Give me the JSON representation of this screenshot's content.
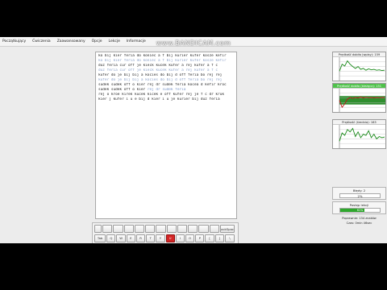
{
  "watermark": "www.BANDICAM.com",
  "menubar": [
    "Początkujący",
    "Ćwiczenia",
    "Zaawansowany",
    "Opcje",
    "Lekcje",
    "Informacje"
  ],
  "text_panel": {
    "lines": [
      {
        "type": "typed",
        "text": "ko bij kier feria do koniec a f bij kurier kufer kosze kefir"
      },
      {
        "type": "target",
        "text": "ko bij kier feria do koniec a f bij kurier kufer kosze kefir"
      },
      {
        "type": "typed",
        "text": "duz feria cur off je kieck kucek kufer a rej kufer a f c"
      },
      {
        "type": "target",
        "text": "duz feria cur off je kieck kucek kufer a rej kufer a f c"
      },
      {
        "type": "typed",
        "text": "kufer do je bij bij a kocies do bij d off feria bo rej rej"
      },
      {
        "type": "target",
        "text": "kufer do je bij bij a kocies do bij d off feria bo rej rej"
      },
      {
        "type": "typed",
        "text": "sudek sudek off o kier rej dr sudek feria kocea d kefir kroc"
      },
      {
        "type": "mixed",
        "text": "sudek sudek off o kier ",
        "tail": "rej dr sudek feria"
      },
      {
        "type": "typed",
        "text": "rej o kroe kirek kucek kicek e off kufer rej je f c dr kruk"
      },
      {
        "type": "typed",
        "text": "kier j kufer i u e bij d kier i u je kurier bij duz feria"
      }
    ]
  },
  "keyboard": {
    "rows": [
      {
        "keys": [
          {
            "label": "",
            "w": 9
          },
          {
            "label": "",
            "w": 12
          },
          {
            "label": "",
            "w": 12
          },
          {
            "label": "",
            "w": 12
          },
          {
            "label": "",
            "w": 12
          },
          {
            "label": "",
            "w": 12
          },
          {
            "label": "",
            "w": 12
          },
          {
            "label": "",
            "w": 12
          },
          {
            "label": "",
            "w": 12
          },
          {
            "label": "",
            "w": 12
          },
          {
            "label": "",
            "w": 12
          },
          {
            "label": "",
            "w": 12
          },
          {
            "label": "BackSpace",
            "w": 18
          }
        ]
      },
      {
        "keys": [
          {
            "label": "Tab",
            "w": 14
          },
          {
            "label": "Q",
            "w": 11
          },
          {
            "label": "W",
            "w": 11
          },
          {
            "label": "E",
            "w": 11
          },
          {
            "label": "R",
            "w": 11
          },
          {
            "label": "T",
            "w": 11
          },
          {
            "label": "Y",
            "w": 11
          },
          {
            "label": "U",
            "w": 11,
            "active": true
          },
          {
            "label": "I",
            "w": 11
          },
          {
            "label": "O",
            "w": 11
          },
          {
            "label": "P",
            "w": 11
          },
          {
            "label": "[",
            "w": 11
          },
          {
            "label": "]",
            "w": 11
          },
          {
            "label": "\\",
            "w": 12
          }
        ]
      },
      {
        "keys": [
          {
            "label": "Caps Lock",
            "w": 17
          },
          {
            "label": "A",
            "w": 11
          },
          {
            "label": "S",
            "w": 11
          },
          {
            "label": "D",
            "w": 11
          },
          {
            "label": "F",
            "w": 11
          },
          {
            "label": "G",
            "w": 11
          },
          {
            "label": "H",
            "w": 11
          },
          {
            "label": "J",
            "w": 11
          },
          {
            "label": "K",
            "w": 11
          },
          {
            "label": "L",
            "w": 11
          },
          {
            "label": ";",
            "w": 11
          },
          {
            "label": "'",
            "w": 11
          },
          {
            "label": "Enter",
            "w": 21
          }
        ]
      },
      {
        "keys": [
          {
            "label": "Shift",
            "w": 24
          },
          {
            "label": "Z",
            "w": 11
          },
          {
            "label": "X",
            "w": 11
          },
          {
            "label": "C",
            "w": 11
          },
          {
            "label": "V",
            "w": 11
          },
          {
            "label": "B",
            "w": 11
          },
          {
            "label": "N",
            "w": 11
          },
          {
            "label": "M",
            "w": 11
          },
          {
            "label": ",",
            "w": 11
          },
          {
            "label": ".",
            "w": 11
          },
          {
            "label": "/",
            "w": 11
          },
          {
            "label": "Shift",
            "w": 26
          }
        ]
      },
      {
        "keys": [
          {
            "label": "Ctrl",
            "w": 14
          },
          {
            "label": "Win",
            "w": 12
          },
          {
            "label": "Alt",
            "w": 12
          },
          {
            "label": "Space",
            "w": 72
          },
          {
            "label": "AltG",
            "w": 12
          },
          {
            "label": "Win",
            "w": 12
          },
          {
            "label": "Win",
            "w": 12
          },
          {
            "label": "Ctrl",
            "w": 14
          }
        ]
      }
    ]
  },
  "graphs": [
    {
      "title": "Prędkość dobiła (wpisy): 159",
      "active": false,
      "colors": {
        "line": "#1a8a1a",
        "grid": "#bfbfbf"
      },
      "series": [
        0.4,
        0.7,
        0.62,
        0.84,
        0.7,
        0.6,
        0.52,
        0.6,
        0.48,
        0.52,
        0.44,
        0.5,
        0.46,
        0.48,
        0.44,
        0.46,
        0.43,
        0.44
      ]
    },
    {
      "title": "Prędkość dobiła (bieżąca): 151",
      "active": true,
      "colors": {
        "line": "#c01818",
        "grid": "#bfbfbf",
        "bg": "#2f8f2f"
      },
      "series": [
        0.5,
        0.2,
        0.35,
        0.55,
        0.62,
        0.58,
        0.62,
        0.6,
        0.64,
        0.6,
        0.63,
        0.61,
        0.62,
        0.6,
        0.62,
        0.61,
        0.62,
        0.62
      ]
    },
    {
      "title": "Prędkość (średnia): 163",
      "active": false,
      "colors": {
        "line": "#1a8a1a",
        "grid": "#bfbfbf"
      },
      "series": [
        0.3,
        0.65,
        0.55,
        0.8,
        0.7,
        0.85,
        0.5,
        0.7,
        0.45,
        0.6,
        0.55,
        0.75,
        0.45,
        0.6,
        0.4,
        0.5,
        0.45,
        0.48
      ]
    }
  ],
  "errors": {
    "label": "Błędy: 2",
    "value": "2%"
  },
  "progress": {
    "label": "Postęp lekcji",
    "value": 61,
    "text": "61%",
    "color": "#2ea82c"
  },
  "summary": [
    "Poprawnie: 134 znaków",
    "Czas: 0min 46sec"
  ]
}
